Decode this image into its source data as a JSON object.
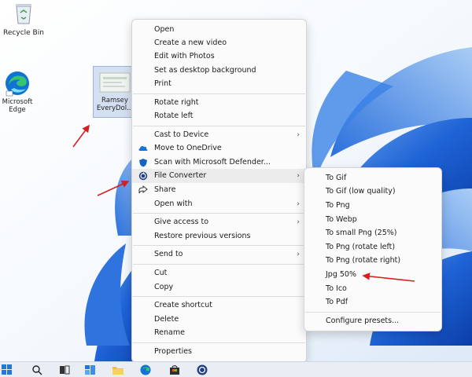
{
  "desktop": {
    "icons": [
      {
        "label": "Recycle Bin"
      },
      {
        "label": "Microsoft Edge"
      },
      {
        "label": "Ramsey EveryDol..."
      }
    ]
  },
  "context_menu": {
    "items": [
      {
        "label": "Open"
      },
      {
        "label": "Create a new video"
      },
      {
        "label": "Edit with Photos"
      },
      {
        "label": "Set as desktop background"
      },
      {
        "label": "Print"
      },
      {
        "label": "Rotate right"
      },
      {
        "label": "Rotate left"
      },
      {
        "label": "Cast to Device"
      },
      {
        "label": "Move to OneDrive"
      },
      {
        "label": "Scan with Microsoft Defender..."
      },
      {
        "label": "File Converter"
      },
      {
        "label": "Share"
      },
      {
        "label": "Open with"
      },
      {
        "label": "Give access to"
      },
      {
        "label": "Restore previous versions"
      },
      {
        "label": "Send to"
      },
      {
        "label": "Cut"
      },
      {
        "label": "Copy"
      },
      {
        "label": "Create shortcut"
      },
      {
        "label": "Delete"
      },
      {
        "label": "Rename"
      },
      {
        "label": "Properties"
      }
    ]
  },
  "submenu": {
    "items": [
      {
        "label": "To Gif"
      },
      {
        "label": "To Gif (low quality)"
      },
      {
        "label": "To Png"
      },
      {
        "label": "To Webp"
      },
      {
        "label": "To small Png (25%)"
      },
      {
        "label": "To Png (rotate left)"
      },
      {
        "label": "To Png (rotate right)"
      },
      {
        "label": "Jpg 50%"
      },
      {
        "label": "To Ico"
      },
      {
        "label": "To Pdf"
      },
      {
        "label": "Configure presets..."
      }
    ]
  },
  "colors": {
    "wallpaper_blue": "#1e63d6",
    "wallpaper_light": "#8fb8ea",
    "arrow_red": "#d42020",
    "highlight": "#ececec"
  }
}
